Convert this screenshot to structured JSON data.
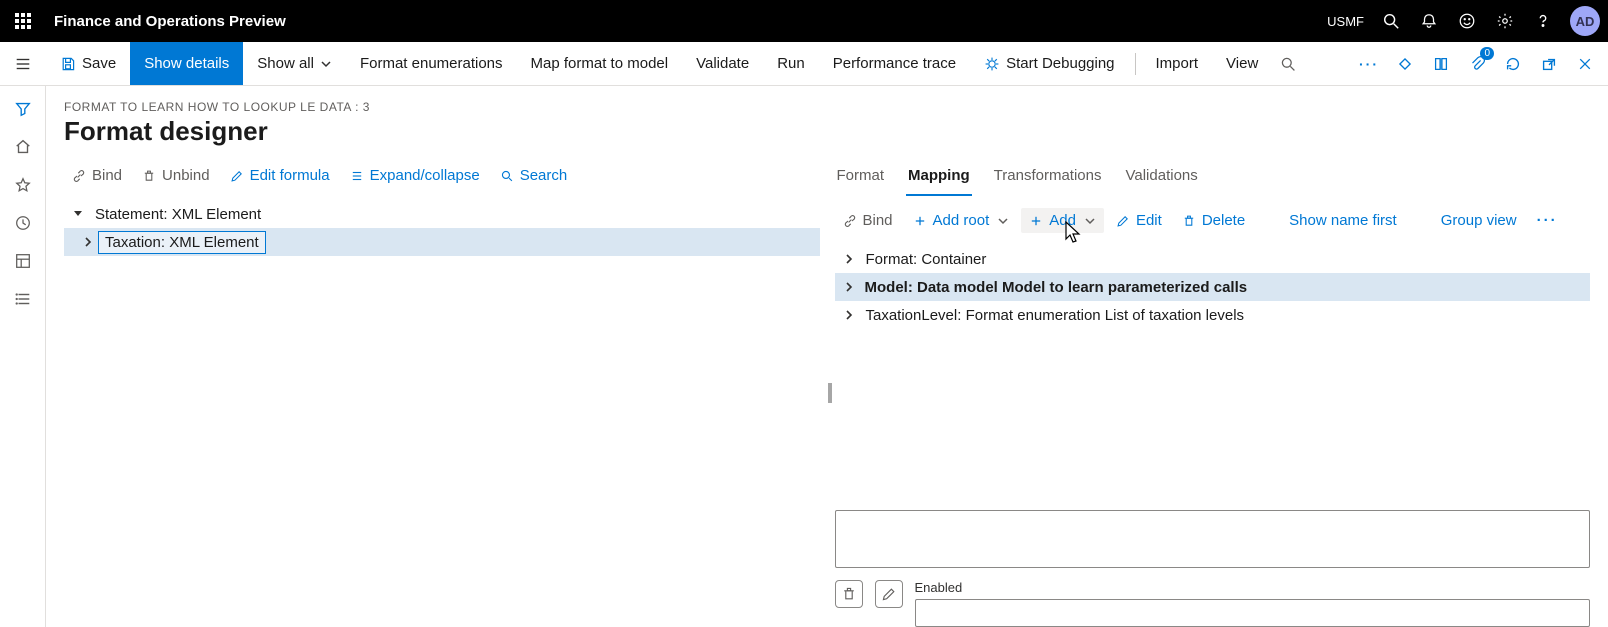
{
  "topbar": {
    "title": "Finance and Operations Preview",
    "entity": "USMF",
    "avatar": "AD"
  },
  "cmdbar": {
    "save": "Save",
    "show_details": "Show details",
    "show_all": "Show all",
    "format_enum": "Format enumerations",
    "map_format": "Map format to model",
    "validate": "Validate",
    "run": "Run",
    "perf_trace": "Performance trace",
    "start_debug": "Start Debugging",
    "import": "Import",
    "view": "View",
    "attach_badge": "0"
  },
  "breadcrumb": "FORMAT TO LEARN HOW TO LOOKUP LE DATA : 3",
  "page_title": "Format designer",
  "leftToolbar": {
    "bind": "Bind",
    "unbind": "Unbind",
    "edit_formula": "Edit formula",
    "expand": "Expand/collapse",
    "search": "Search"
  },
  "leftTree": {
    "root": "Statement: XML Element",
    "child": "Taxation: XML Element"
  },
  "tabs": {
    "format": "Format",
    "mapping": "Mapping",
    "transformations": "Transformations",
    "validations": "Validations"
  },
  "rightToolbar": {
    "bind": "Bind",
    "add_root": "Add root",
    "add": "Add",
    "edit": "Edit",
    "delete": "Delete",
    "show_name_first": "Show name first",
    "group_view": "Group view"
  },
  "rightTree": {
    "n0": "Format: Container",
    "n1": "Model: Data model Model to learn parameterized calls",
    "n2": "TaxationLevel: Format enumeration List of taxation levels"
  },
  "bottom": {
    "enabled_label": "Enabled"
  }
}
